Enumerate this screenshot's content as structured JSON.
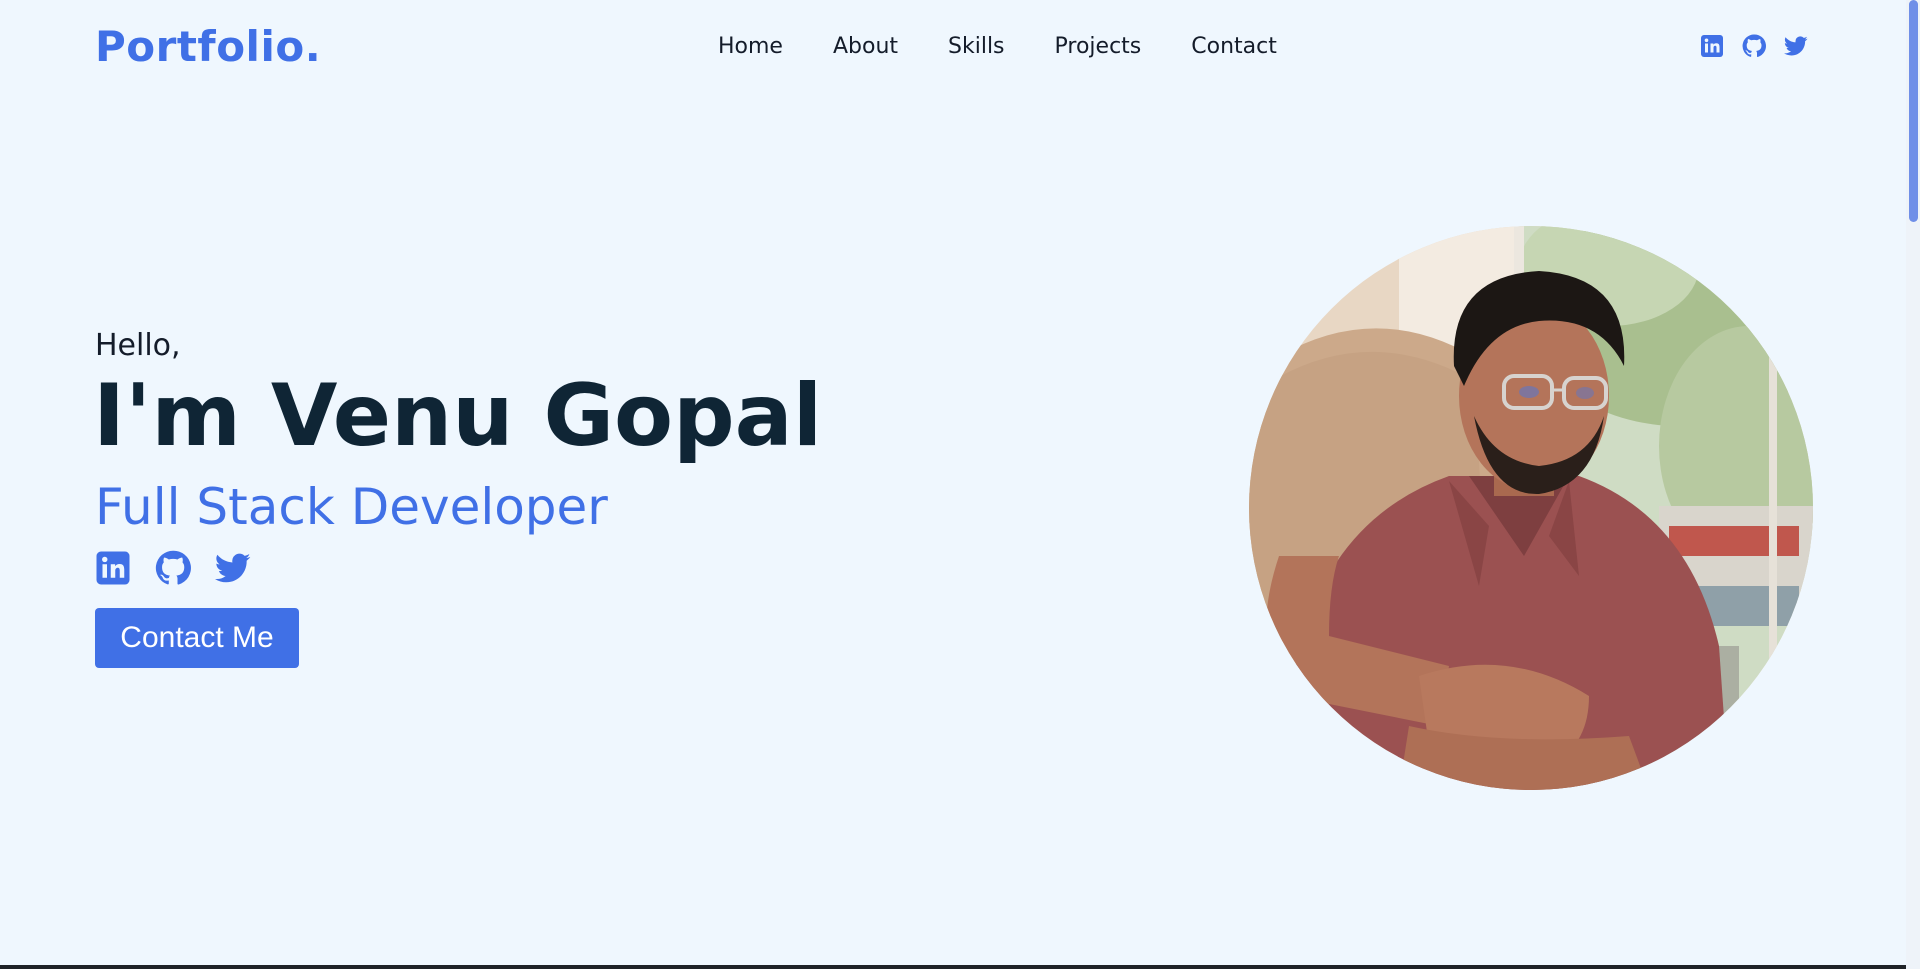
{
  "header": {
    "logo": "Portfolio.",
    "nav": [
      "Home",
      "About",
      "Skills",
      "Projects",
      "Contact"
    ],
    "icons": [
      "linkedin-icon",
      "github-icon",
      "twitter-icon"
    ]
  },
  "hero": {
    "greeting": "Hello,",
    "name": "I'm Venu Gopal",
    "role": "Full Stack Developer",
    "social_icons": [
      "linkedin-icon",
      "github-icon",
      "twitter-icon"
    ],
    "cta_label": "Contact Me"
  },
  "colors": {
    "background": "#eff7fe",
    "accent": "#4070e6",
    "heading": "#0f2535",
    "text": "#141c2a"
  }
}
